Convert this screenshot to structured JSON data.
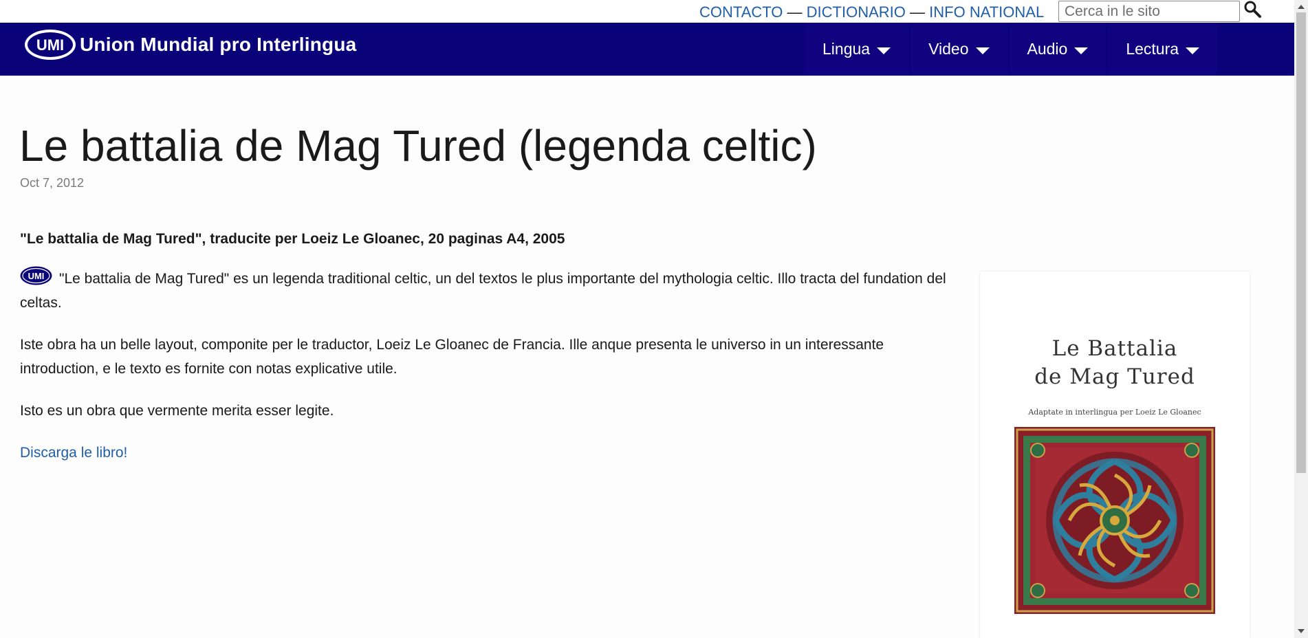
{
  "topbar": {
    "links": [
      "CONTACTO",
      "DICTIONARIO",
      "INFO NATIONAL"
    ],
    "separator": "—",
    "search_placeholder": "Cerca in le sito"
  },
  "navbar": {
    "logo_badge": "UMI",
    "logo_text": "Union Mundial pro Interlingua",
    "menu": [
      "Lingua",
      "Video",
      "Audio",
      "Lectura"
    ]
  },
  "article": {
    "title": "Le battalia de Mag Tured (legenda celtic)",
    "date": "Oct 7, 2012",
    "lead": "\"Le battalia de Mag Tured\", traducite per Loeiz Le Gloanec, 20 paginas A4, 2005",
    "inline_logo": "UMI",
    "paragraphs": [
      "\"Le battalia de Mag Tured\" es un legenda traditional celtic, un del textos le plus importante del mythologia celtic. Illo tracta del fundation del celtas.",
      "Iste obra ha un belle layout, componite per le traductor, Loeiz Le Gloanec de Francia. Ille anque presenta le universo in un interessante introduction, e le texto es fornite con notas explicative utile.",
      "Isto es un obra que vermente merita esser legite."
    ],
    "download_link": "Discarga le libro!"
  },
  "cover": {
    "title_line1": "Le Battalia",
    "title_line2": "de Mag Tured",
    "subtitle": "Adaptate in interlingua per Loeiz Le Gloanec"
  },
  "colors": {
    "nav_bg": "#0a0278",
    "link": "#1f5fa8"
  }
}
